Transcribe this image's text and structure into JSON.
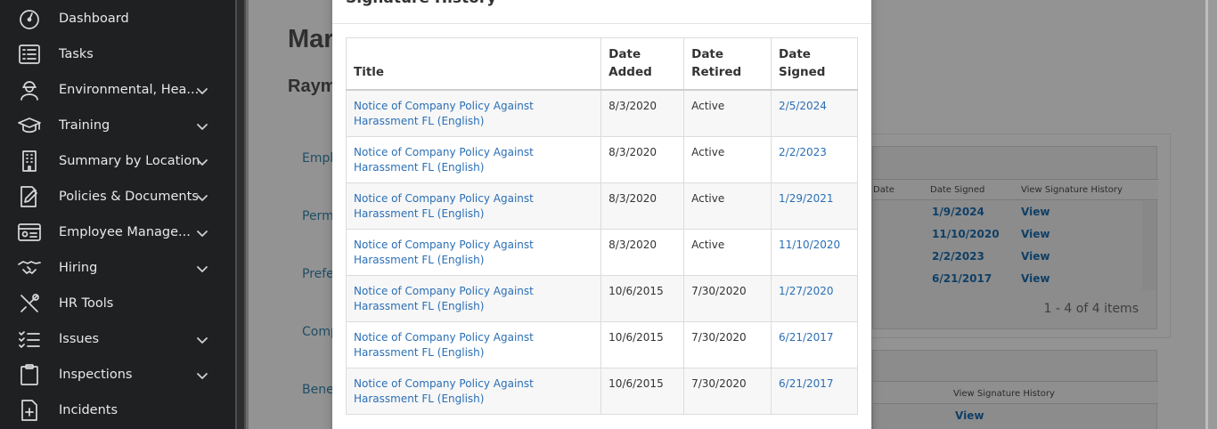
{
  "sidebar": {
    "items": [
      {
        "label": "Dashboard",
        "icon": "dashboard-gauge-icon",
        "chevron": false
      },
      {
        "label": "Tasks",
        "icon": "task-list-icon",
        "chevron": false
      },
      {
        "label": "Environmental, Hea...",
        "icon": "worker-helmet-icon",
        "chevron": true
      },
      {
        "label": "Training",
        "icon": "graduation-cap-icon",
        "chevron": true
      },
      {
        "label": "Summary by Location",
        "icon": "building-icon",
        "chevron": true
      },
      {
        "label": "Policies & Documents",
        "icon": "document-pen-icon",
        "chevron": true
      },
      {
        "label": "Employee Manage...",
        "icon": "id-card-icon",
        "chevron": true
      },
      {
        "label": "Hiring",
        "icon": "handshake-icon",
        "chevron": true
      },
      {
        "label": "HR Tools",
        "icon": "tools-icon",
        "chevron": false
      },
      {
        "label": "Issues",
        "icon": "checklist-icon",
        "chevron": true
      },
      {
        "label": "Inspections",
        "icon": "clipboard-icon",
        "chevron": true
      },
      {
        "label": "Incidents",
        "icon": "medical-document-icon",
        "chevron": false
      }
    ]
  },
  "background": {
    "title": "Mar",
    "subtitle": "Raym",
    "links": [
      "Empl",
      "Perm",
      "Prefe",
      "Comp",
      "Benet"
    ],
    "grid1": {
      "headers": [
        "Date",
        "Date Signed",
        "View Signature History"
      ],
      "rows": [
        {
          "date_signed": "1/9/2024",
          "view": "View"
        },
        {
          "date_signed": "11/10/2020",
          "view": "View"
        },
        {
          "date_signed": "2/2/2023",
          "view": "View"
        },
        {
          "date_signed": "6/21/2017",
          "view": "View"
        }
      ],
      "pager": "1 - 4 of 4 items"
    },
    "grid2": {
      "headers": [
        "View Signature History"
      ],
      "view": "View"
    }
  },
  "modal": {
    "title": "Signature History",
    "columns": [
      "Title",
      "Date Added",
      "Date Retired",
      "Date Signed"
    ],
    "rows": [
      {
        "title": "Notice of Company Policy Against Harassment FL (English)",
        "added": "8/3/2020",
        "retired": "Active",
        "signed": "2/5/2024"
      },
      {
        "title": "Notice of Company Policy Against Harassment FL (English)",
        "added": "8/3/2020",
        "retired": "Active",
        "signed": "2/2/2023"
      },
      {
        "title": "Notice of Company Policy Against Harassment FL (English)",
        "added": "8/3/2020",
        "retired": "Active",
        "signed": "1/29/2021"
      },
      {
        "title": "Notice of Company Policy Against Harassment FL (English)",
        "added": "8/3/2020",
        "retired": "Active",
        "signed": "11/10/2020"
      },
      {
        "title": "Notice of Company Policy Against Harassment FL (English)",
        "added": "10/6/2015",
        "retired": "7/30/2020",
        "signed": "1/27/2020"
      },
      {
        "title": "Notice of Company Policy Against Harassment FL (English)",
        "added": "10/6/2015",
        "retired": "7/30/2020",
        "signed": "6/21/2017"
      },
      {
        "title": "Notice of Company Policy Against Harassment FL (English)",
        "added": "10/6/2015",
        "retired": "7/30/2020",
        "signed": "6/21/2017"
      }
    ]
  },
  "colors": {
    "sidebar_bg": "#1f2021",
    "link": "#2a6fb6",
    "overlay": "#939393"
  }
}
